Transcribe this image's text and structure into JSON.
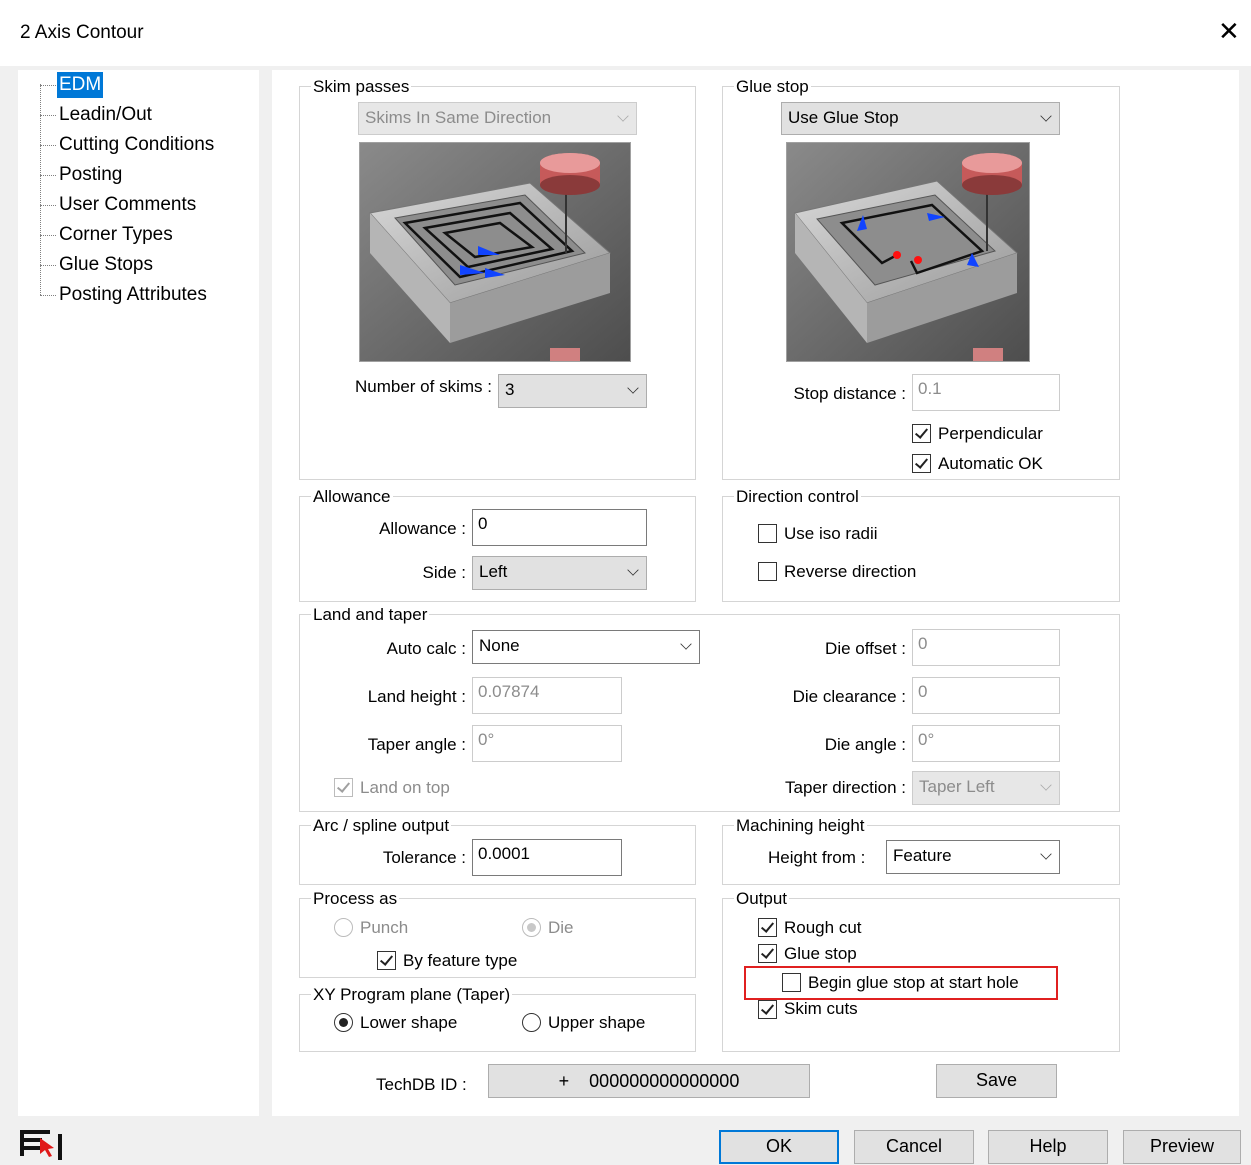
{
  "window": {
    "title": "2 Axis Contour"
  },
  "tree": {
    "items": [
      {
        "label": "EDM",
        "selected": true
      },
      {
        "label": "Leadin/Out"
      },
      {
        "label": "Cutting Conditions"
      },
      {
        "label": "Posting"
      },
      {
        "label": "User Comments"
      },
      {
        "label": "Corner Types"
      },
      {
        "label": "Glue Stops"
      },
      {
        "label": "Posting Attributes"
      }
    ]
  },
  "skim_passes": {
    "title": "Skim passes",
    "mode": "Skims In Same Direction",
    "num_label": "Number of skims :",
    "num_value": "3"
  },
  "glue_stop": {
    "title": "Glue stop",
    "mode": "Use Glue Stop",
    "stop_distance_label": "Stop distance :",
    "stop_distance_value": "0.1",
    "perpendicular_label": "Perpendicular",
    "perpendicular_checked": true,
    "automatic_ok_label": "Automatic OK",
    "automatic_ok_checked": true
  },
  "allowance": {
    "title": "Allowance",
    "allowance_label": "Allowance :",
    "allowance_value": "0",
    "side_label": "Side :",
    "side_value": "Left"
  },
  "direction_control": {
    "title": "Direction control",
    "iso_radii_label": "Use iso radii",
    "iso_radii_checked": false,
    "reverse_label": "Reverse direction",
    "reverse_checked": false
  },
  "land_taper": {
    "title": "Land and taper",
    "auto_calc_label": "Auto calc :",
    "auto_calc_value": "None",
    "land_height_label": "Land height :",
    "land_height_value": "0.07874",
    "taper_angle_label": "Taper angle :",
    "taper_angle_value": "0°",
    "land_on_top_label": "Land on top",
    "land_on_top_checked": true,
    "die_offset_label": "Die offset :",
    "die_offset_value": "0",
    "die_clearance_label": "Die clearance :",
    "die_clearance_value": "0",
    "die_angle_label": "Die angle :",
    "die_angle_value": "0°",
    "taper_direction_label": "Taper direction :",
    "taper_direction_value": "Taper Left"
  },
  "arc_spline": {
    "title": "Arc / spline output",
    "tolerance_label": "Tolerance :",
    "tolerance_value": "0.0001"
  },
  "machining_height": {
    "title": "Machining height",
    "height_from_label": "Height from :",
    "height_from_value": "Feature"
  },
  "process_as": {
    "title": "Process as",
    "punch_label": "Punch",
    "die_label": "Die",
    "by_feature_label": "By feature type",
    "by_feature_checked": true
  },
  "xy_plane": {
    "title": "XY Program plane (Taper)",
    "lower_label": "Lower shape",
    "upper_label": "Upper shape",
    "selected": "Lower shape"
  },
  "output": {
    "title": "Output",
    "rough_cut_label": "Rough cut",
    "rough_cut_checked": true,
    "glue_stop_label": "Glue stop",
    "glue_stop_checked": true,
    "begin_glue_label": "Begin glue stop at start hole",
    "begin_glue_checked": false,
    "skim_cuts_label": "Skim cuts",
    "skim_cuts_checked": true
  },
  "techdb": {
    "label": "TechDB ID :",
    "value": "+    000000000000000",
    "save_label": "Save"
  },
  "footer": {
    "ok_label": "OK",
    "cancel_label": "Cancel",
    "help_label": "Help",
    "preview_label": "Preview"
  },
  "colors": {
    "accent": "#0078d7",
    "highlight": "#e02020",
    "tool_red": "#d9534f"
  }
}
